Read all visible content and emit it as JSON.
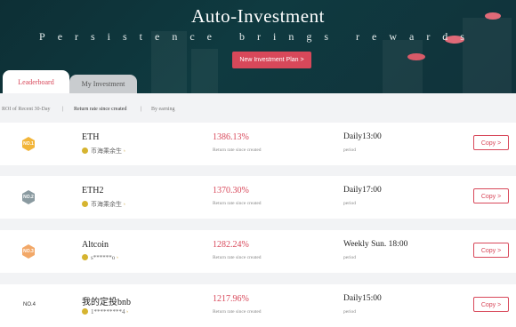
{
  "hero": {
    "title": "Auto-Investment",
    "subtitle": "Persistence brings rewards",
    "new_plan_label": "New Investment Plan >"
  },
  "tabs": [
    {
      "label": "Leaderboard",
      "active": true
    },
    {
      "label": "My Investment",
      "active": false
    }
  ],
  "filters": {
    "roi_recent": "ROI of Recent 30-Day",
    "separator": "|",
    "since_created": "Return rate since created",
    "by_earning": "By earning"
  },
  "rows": [
    {
      "rank": "NO.1",
      "badge_color": "#f2b53a",
      "name": "ETH",
      "user": "币海乘余生",
      "roi": "1386.13%",
      "roi_label": "Return rate since created",
      "period": "Daily13:00",
      "period_label": "period",
      "copy_label": "Copy >"
    },
    {
      "rank": "NO.2",
      "badge_color": "#8a9aa0",
      "name": "ETH2",
      "user": "币海乘余生",
      "roi": "1370.30%",
      "roi_label": "Return rate since created",
      "period": "Daily17:00",
      "period_label": "period",
      "copy_label": "Copy >"
    },
    {
      "rank": "NO.3",
      "badge_color": "#f2a868",
      "name": "Altcoin",
      "user": "s******o",
      "roi": "1282.24%",
      "roi_label": "Return rate since created",
      "period": "Weekly Sun. 18:00",
      "period_label": "period",
      "copy_label": "Copy >"
    },
    {
      "rank": "NO.4",
      "badge_color": "",
      "name": "我的定投bnb",
      "user": "1*********4",
      "roi": "1217.96%",
      "roi_label": "Return rate since created",
      "period": "Daily15:00",
      "period_label": "period",
      "copy_label": "Copy >"
    }
  ],
  "colors": {
    "accent": "#d8485a",
    "hero_bg": "#0f3a40"
  }
}
